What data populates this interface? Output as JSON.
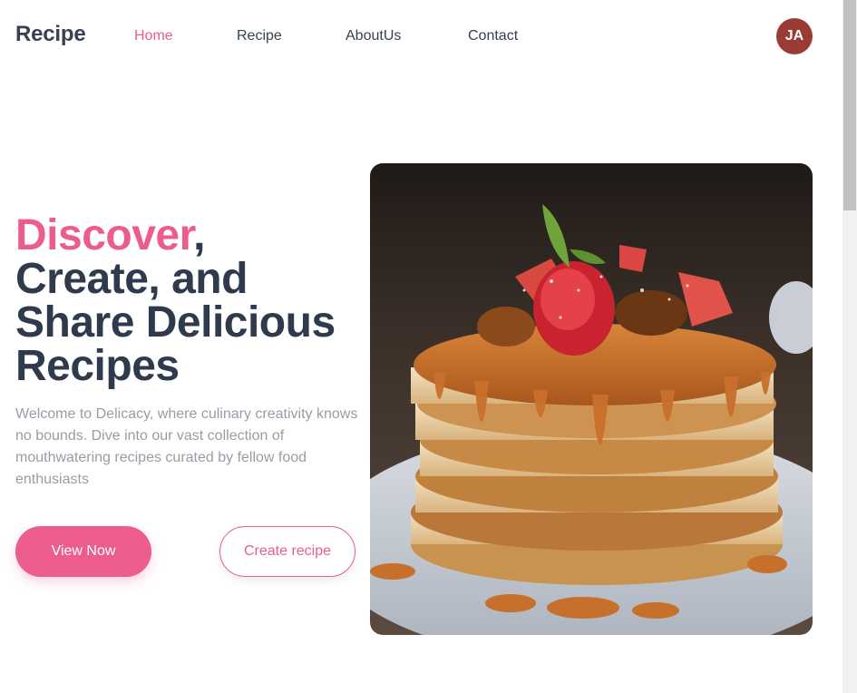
{
  "nav": {
    "brand": "Recipe",
    "links": [
      {
        "label": "Home",
        "active": true
      },
      {
        "label": "Recipe",
        "active": false
      },
      {
        "label": "AboutUs",
        "active": false
      },
      {
        "label": "Contact",
        "active": false
      }
    ],
    "avatar_initials": "JA"
  },
  "hero": {
    "headline_accent": "Discover",
    "headline_line1_rest": ",",
    "headline_line2": "Create, and",
    "headline_line3": "Share Delicious",
    "headline_line4": "Recipes",
    "description": "Welcome to Delicacy, where culinary creativity knows no bounds. Dive into our vast collection of mouthwatering recipes curated by fellow food enthusiasts",
    "primary_button": "View Now",
    "secondary_button": "Create recipe",
    "image_icon": "pancake-stack-photo"
  },
  "colors": {
    "accent": "#ec5c8d",
    "heading": "#2f3a4d",
    "body_text": "#9a9ca5",
    "avatar_bg": "#9b3c34"
  }
}
